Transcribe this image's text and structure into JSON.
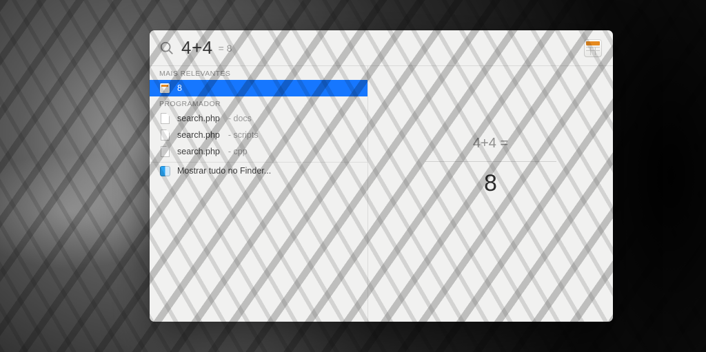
{
  "search": {
    "query": "4+4",
    "inline_result_prefix": "= ",
    "inline_result_value": "8"
  },
  "top_hit_icon": "calculator-icon",
  "sections": [
    {
      "title": "MAIS RELEVANTES",
      "items": [
        {
          "icon": "calculator-mini-icon",
          "label": "8",
          "sub": "",
          "selected": true
        }
      ]
    },
    {
      "title": "PROGRAMADOR",
      "items": [
        {
          "icon": "document-icon",
          "label": "search.php",
          "sub": "- docs",
          "selected": false
        },
        {
          "icon": "document-icon",
          "label": "search.php",
          "sub": "- scripts",
          "selected": false
        },
        {
          "icon": "document-icon",
          "label": "search.php",
          "sub": "- cpp",
          "selected": false
        }
      ]
    }
  ],
  "show_all": {
    "icon": "finder-icon",
    "label": "Mostrar tudo no Finder..."
  },
  "preview": {
    "expression": "4+4 =",
    "result": "8"
  }
}
